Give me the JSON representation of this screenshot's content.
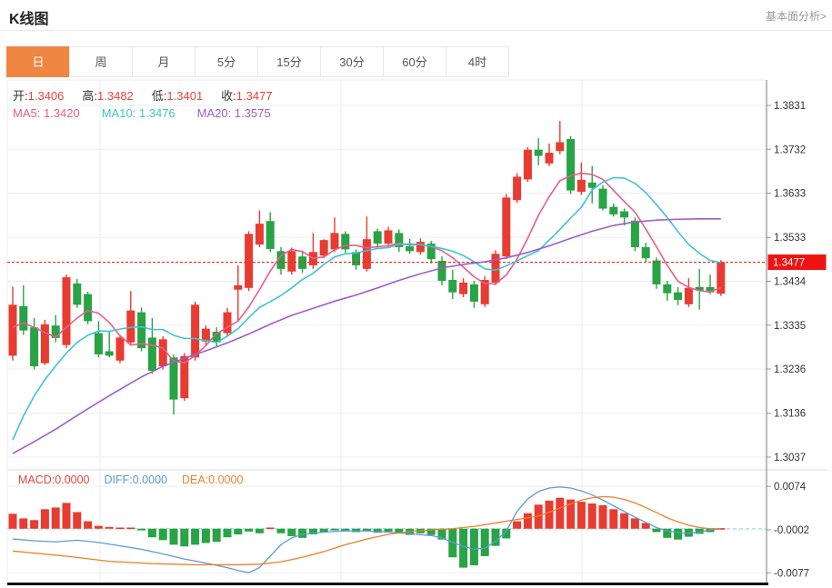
{
  "header": {
    "title": "K线图",
    "link": "基本面分析>"
  },
  "tabs": {
    "items": [
      "日",
      "周",
      "月",
      "5分",
      "15分",
      "30分",
      "60分",
      "4时"
    ],
    "active_index": 0
  },
  "ohlc": {
    "open_label": "开:",
    "open": "1.3406",
    "high_label": "高:",
    "high": "1.3482",
    "low_label": "低:",
    "low": "1.3401",
    "close_label": "收:",
    "close": "1.3477"
  },
  "ma_legend": {
    "ma5": "MA5: 1.3420",
    "ma10": "MA10: 1.3476",
    "ma20": "MA20: 1.3575"
  },
  "macd_legend": {
    "macd": "MACD:0.0000",
    "diff": "DIFF:0.0000",
    "dea": "DEA:0.0000"
  },
  "price_marker": "1.3477",
  "colors": {
    "up": "#e83b32",
    "down": "#28a345",
    "ma5": "#e85d8a",
    "ma10": "#3fc3d4",
    "ma20": "#9e5fc4",
    "diff": "#5b9bd5",
    "dea": "#ed8128",
    "tab_active": "#ef8642",
    "marker_bg": "#ee1313",
    "price_line": "#f32b1e",
    "zero_line": "#9adbe8",
    "grid": "#ededed",
    "vgrid": "#e7edf3",
    "axis": "#777",
    "legend_value": "#e8453c"
  },
  "chart_data": {
    "type": "candlestick+macd",
    "main": {
      "ylim": [
        1.3037,
        1.3831
      ],
      "yticks": [
        1.3831,
        1.3732,
        1.3633,
        1.3533,
        1.3434,
        1.3335,
        1.3236,
        1.3136,
        1.3037
      ],
      "price_line": 1.3477,
      "candles_ohlc": [
        [
          1.3266,
          1.3422,
          1.3255,
          1.3381
        ],
        [
          1.3378,
          1.3425,
          1.3313,
          1.3323
        ],
        [
          1.333,
          1.3351,
          1.3235,
          1.3242
        ],
        [
          1.3249,
          1.3347,
          1.3245,
          1.3337
        ],
        [
          1.3334,
          1.3358,
          1.3296,
          1.3306
        ],
        [
          1.329,
          1.3449,
          1.3283,
          1.3443
        ],
        [
          1.3429,
          1.3439,
          1.3374,
          1.3381
        ],
        [
          1.3405,
          1.341,
          1.3337,
          1.3344
        ],
        [
          1.3317,
          1.3344,
          1.3262,
          1.3269
        ],
        [
          1.3276,
          1.332,
          1.3262,
          1.3266
        ],
        [
          1.3255,
          1.3313,
          1.3249,
          1.3307
        ],
        [
          1.3296,
          1.3412,
          1.329,
          1.3368
        ],
        [
          1.3364,
          1.3375,
          1.3276,
          1.3283
        ],
        [
          1.3307,
          1.3351,
          1.3225,
          1.3232
        ],
        [
          1.3242,
          1.331,
          1.3235,
          1.3303
        ],
        [
          1.3262,
          1.3269,
          1.3133,
          1.3167
        ],
        [
          1.317,
          1.3272,
          1.3164,
          1.3265
        ],
        [
          1.3262,
          1.3388,
          1.3255,
          1.3381
        ],
        [
          1.3298,
          1.3334,
          1.329,
          1.3327
        ],
        [
          1.332,
          1.333,
          1.3286,
          1.3296
        ],
        [
          1.3317,
          1.3374,
          1.3309,
          1.3364
        ],
        [
          1.3415,
          1.347,
          1.3344,
          1.3425
        ],
        [
          1.3419,
          1.3547,
          1.3412,
          1.3541
        ],
        [
          1.3517,
          1.3594,
          1.3511,
          1.3564
        ],
        [
          1.357,
          1.359,
          1.35,
          1.3507
        ],
        [
          1.3502,
          1.3511,
          1.3449,
          1.3462
        ],
        [
          1.3456,
          1.351,
          1.3449,
          1.3502
        ],
        [
          1.349,
          1.3502,
          1.3453,
          1.3462
        ],
        [
          1.347,
          1.3543,
          1.3462,
          1.35
        ],
        [
          1.3492,
          1.3529,
          1.3486,
          1.3527
        ],
        [
          1.3506,
          1.3578,
          1.35,
          1.3543
        ],
        [
          1.3541,
          1.3547,
          1.3498,
          1.3506
        ],
        [
          1.35,
          1.3506,
          1.346,
          1.347
        ],
        [
          1.3462,
          1.358,
          1.3456,
          1.3529
        ],
        [
          1.3547,
          1.3553,
          1.351,
          1.3519
        ],
        [
          1.3519,
          1.3557,
          1.3512,
          1.3549
        ],
        [
          1.3543,
          1.3551,
          1.35,
          1.3511
        ],
        [
          1.3513,
          1.353,
          1.3496,
          1.3502
        ],
        [
          1.35,
          1.3531,
          1.3494,
          1.3523
        ],
        [
          1.3519,
          1.3525,
          1.3474,
          1.3484
        ],
        [
          1.348,
          1.349,
          1.3425,
          1.3435
        ],
        [
          1.3437,
          1.346,
          1.3394,
          1.3409
        ],
        [
          1.3405,
          1.3441,
          1.3398,
          1.3431
        ],
        [
          1.3427,
          1.3435,
          1.3374,
          1.3388
        ],
        [
          1.3382,
          1.3445,
          1.3376,
          1.3437
        ],
        [
          1.3431,
          1.3504,
          1.3425,
          1.3496
        ],
        [
          1.349,
          1.3631,
          1.3484,
          1.3623
        ],
        [
          1.3617,
          1.3678,
          1.3611,
          1.367
        ],
        [
          1.3664,
          1.3737,
          1.3658,
          1.3731
        ],
        [
          1.3731,
          1.3757,
          1.3696,
          1.3717
        ],
        [
          1.37,
          1.3745,
          1.3694,
          1.3724
        ],
        [
          1.3728,
          1.3796,
          1.3721,
          1.3748
        ],
        [
          1.3755,
          1.3762,
          1.3631,
          1.3639
        ],
        [
          1.3636,
          1.3702,
          1.3629,
          1.3663
        ],
        [
          1.3657,
          1.3694,
          1.361,
          1.3645
        ],
        [
          1.3643,
          1.3651,
          1.3594,
          1.3598
        ],
        [
          1.3602,
          1.361,
          1.358,
          1.3585
        ],
        [
          1.3592,
          1.3598,
          1.356,
          1.3578
        ],
        [
          1.3571,
          1.3578,
          1.3502,
          1.3511
        ],
        [
          1.3511,
          1.3521,
          1.3478,
          1.3486
        ],
        [
          1.3481,
          1.3488,
          1.3417,
          1.3427
        ],
        [
          1.3427,
          1.3435,
          1.339,
          1.3407
        ],
        [
          1.3409,
          1.3421,
          1.338,
          1.3392
        ],
        [
          1.3382,
          1.3441,
          1.3376,
          1.3419
        ],
        [
          1.3421,
          1.3462,
          1.337,
          1.3413
        ],
        [
          1.3421,
          1.3449,
          1.3405,
          1.3409
        ],
        [
          1.3406,
          1.3482,
          1.3401,
          1.3477
        ]
      ],
      "ma5": [
        1.333,
        1.334,
        1.333,
        1.3318,
        1.3308,
        1.333,
        1.3351,
        1.3368,
        1.3362,
        1.3341,
        1.3311,
        1.329,
        1.3293,
        1.329,
        1.3283,
        1.3254,
        1.325,
        1.3266,
        1.3289,
        1.3316,
        1.333,
        1.3344,
        1.3376,
        1.3415,
        1.3457,
        1.3492,
        1.3506,
        1.3501,
        1.3486,
        1.3489,
        1.3505,
        1.3515,
        1.3515,
        1.3509,
        1.3512,
        1.3514,
        1.352,
        1.3516,
        1.3517,
        1.3512,
        1.3503,
        1.3487,
        1.3466,
        1.3444,
        1.3429,
        1.3428,
        1.3448,
        1.3484,
        1.3531,
        1.3583,
        1.3625,
        1.3661,
        1.3672,
        1.3678,
        1.3675,
        1.3664,
        1.3639,
        1.3614,
        1.359,
        1.3552,
        1.3512,
        1.347,
        1.3434,
        1.342,
        1.3413,
        1.341,
        1.342
      ],
      "ma10": [
        1.3076,
        1.313,
        1.3175,
        1.3212,
        1.3243,
        1.3272,
        1.3296,
        1.3312,
        1.3322,
        1.3321,
        1.3326,
        1.333,
        1.3331,
        1.3325,
        1.3325,
        1.3312,
        1.3305,
        1.3305,
        1.33,
        1.3296,
        1.331,
        1.3327,
        1.3352,
        1.3375,
        1.3388,
        1.3402,
        1.3419,
        1.3438,
        1.3452,
        1.3472,
        1.3489,
        1.3496,
        1.3498,
        1.3503,
        1.3508,
        1.351,
        1.3517,
        1.3518,
        1.3517,
        1.3513,
        1.3508,
        1.3502,
        1.3492,
        1.3478,
        1.3462,
        1.3459,
        1.3469,
        1.348,
        1.3492,
        1.3503,
        1.3527,
        1.3551,
        1.3577,
        1.3601,
        1.364,
        1.3658,
        1.3668,
        1.3667,
        1.3655,
        1.3634,
        1.3607,
        1.3578,
        1.3546,
        1.3517,
        1.3497,
        1.3481,
        1.3476
      ],
      "ma20_points": [
        [
          1,
          1.3045
        ],
        [
          3,
          1.3072
        ],
        [
          5,
          1.31
        ],
        [
          7,
          1.3131
        ],
        [
          9,
          1.3161
        ],
        [
          11,
          1.319
        ],
        [
          13,
          1.3218
        ],
        [
          15,
          1.3242
        ],
        [
          17,
          1.326
        ],
        [
          19,
          1.3277
        ],
        [
          21,
          1.3295
        ],
        [
          23,
          1.3315
        ],
        [
          25,
          1.3337
        ],
        [
          27,
          1.3357
        ],
        [
          29,
          1.3373
        ],
        [
          31,
          1.3389
        ],
        [
          33,
          1.3403
        ],
        [
          35,
          1.3419
        ],
        [
          37,
          1.3436
        ],
        [
          39,
          1.3451
        ],
        [
          41,
          1.3464
        ],
        [
          43,
          1.3472
        ],
        [
          45,
          1.3478
        ],
        [
          47,
          1.3487
        ],
        [
          49,
          1.3499
        ],
        [
          51,
          1.3514
        ],
        [
          53,
          1.3531
        ],
        [
          55,
          1.3547
        ],
        [
          57,
          1.356
        ],
        [
          59,
          1.3568
        ],
        [
          61,
          1.3572
        ],
        [
          63,
          1.3574
        ],
        [
          65,
          1.3575
        ],
        [
          67,
          1.3575
        ]
      ]
    },
    "macd": {
      "ylim": [
        -0.0077,
        0.0074
      ],
      "yticks": [
        0.0074,
        -0.0002,
        -0.0077
      ],
      "bars": [
        0.0026,
        0.0018,
        0.0015,
        0.0034,
        0.0037,
        0.0045,
        0.0029,
        0.0013,
        0.0005,
        0.0003,
        0.0002,
        0.0002,
        -0.0003,
        -0.0015,
        -0.002,
        -0.0028,
        -0.0031,
        -0.0028,
        -0.0025,
        -0.0023,
        -0.0015,
        -0.001,
        -0.0005,
        -0.0008,
        0.0002,
        -0.0008,
        -0.0013,
        -0.0016,
        -0.001,
        -0.0007,
        -0.0003,
        -0.0004,
        -0.0006,
        -0.0004,
        -0.0007,
        -0.0005,
        -0.0008,
        -0.0011,
        -0.0008,
        -0.0011,
        -0.0019,
        -0.005,
        -0.0068,
        -0.0064,
        -0.0048,
        -0.003,
        -0.0017,
        0.0013,
        0.0027,
        0.0042,
        0.0049,
        0.0054,
        0.0051,
        0.0047,
        0.0044,
        0.0041,
        0.0034,
        0.0027,
        0.0018,
        0.001,
        -0.0006,
        -0.0016,
        -0.0019,
        -0.0014,
        -0.0009,
        -0.0006,
        0.0001
      ],
      "diff_points": [
        [
          1,
          -0.0018
        ],
        [
          3,
          -0.0021
        ],
        [
          5,
          -0.0023
        ],
        [
          7,
          -0.002
        ],
        [
          9,
          -0.0024
        ],
        [
          11,
          -0.003
        ],
        [
          13,
          -0.0036
        ],
        [
          15,
          -0.0044
        ],
        [
          17,
          -0.0053
        ],
        [
          19,
          -0.006
        ],
        [
          21,
          -0.0068
        ],
        [
          22,
          -0.0073
        ],
        [
          23,
          -0.0077
        ],
        [
          24,
          -0.0068
        ],
        [
          25,
          -0.0048
        ],
        [
          26,
          -0.0028
        ],
        [
          27,
          -0.0016
        ],
        [
          28,
          -0.001
        ],
        [
          30,
          -0.0006
        ],
        [
          32,
          -0.0004
        ],
        [
          34,
          -0.0004
        ],
        [
          36,
          -0.0006
        ],
        [
          38,
          -0.0009
        ],
        [
          40,
          -0.0012
        ],
        [
          41,
          -0.0016
        ],
        [
          42,
          -0.0024
        ],
        [
          43,
          -0.0031
        ],
        [
          44,
          -0.0036
        ],
        [
          45,
          -0.0034
        ],
        [
          46,
          -0.0022
        ],
        [
          47,
          -0.0004
        ],
        [
          48,
          0.003
        ],
        [
          49,
          0.0052
        ],
        [
          50,
          0.0065
        ],
        [
          51,
          0.0071
        ],
        [
          52,
          0.0073
        ],
        [
          53,
          0.0071
        ],
        [
          54,
          0.0066
        ],
        [
          55,
          0.0059
        ],
        [
          56,
          0.005
        ],
        [
          57,
          0.004
        ],
        [
          58,
          0.003
        ],
        [
          59,
          0.002
        ],
        [
          60,
          0.0011
        ],
        [
          61,
          0.0002
        ],
        [
          62,
          -0.0004
        ],
        [
          63,
          -0.0007
        ],
        [
          64,
          -0.0008
        ],
        [
          65,
          -0.0006
        ],
        [
          66,
          -0.0002
        ],
        [
          67,
          0.0
        ]
      ],
      "dea_points": [
        [
          1,
          -0.0039
        ],
        [
          6,
          -0.0048
        ],
        [
          10,
          -0.0057
        ],
        [
          14,
          -0.0061
        ],
        [
          18,
          -0.0063
        ],
        [
          22,
          -0.0063
        ],
        [
          24,
          -0.0062
        ],
        [
          26,
          -0.0058
        ],
        [
          28,
          -0.005
        ],
        [
          30,
          -0.004
        ],
        [
          32,
          -0.0028
        ],
        [
          34,
          -0.0018
        ],
        [
          36,
          -0.001
        ],
        [
          38,
          -0.0005
        ],
        [
          40,
          -0.0002
        ],
        [
          42,
          0.0
        ],
        [
          44,
          0.0004
        ],
        [
          46,
          0.001
        ],
        [
          48,
          0.0016
        ],
        [
          50,
          0.0022
        ],
        [
          52,
          0.0036
        ],
        [
          54,
          0.005
        ],
        [
          55,
          0.0054
        ],
        [
          56,
          0.0056
        ],
        [
          57,
          0.0055
        ],
        [
          58,
          0.0051
        ],
        [
          59,
          0.0045
        ],
        [
          60,
          0.0037
        ],
        [
          61,
          0.0028
        ],
        [
          62,
          0.0019
        ],
        [
          63,
          0.0012
        ],
        [
          64,
          0.0006
        ],
        [
          65,
          0.0002
        ],
        [
          66,
          0.0
        ],
        [
          67,
          0.0
        ]
      ]
    }
  }
}
